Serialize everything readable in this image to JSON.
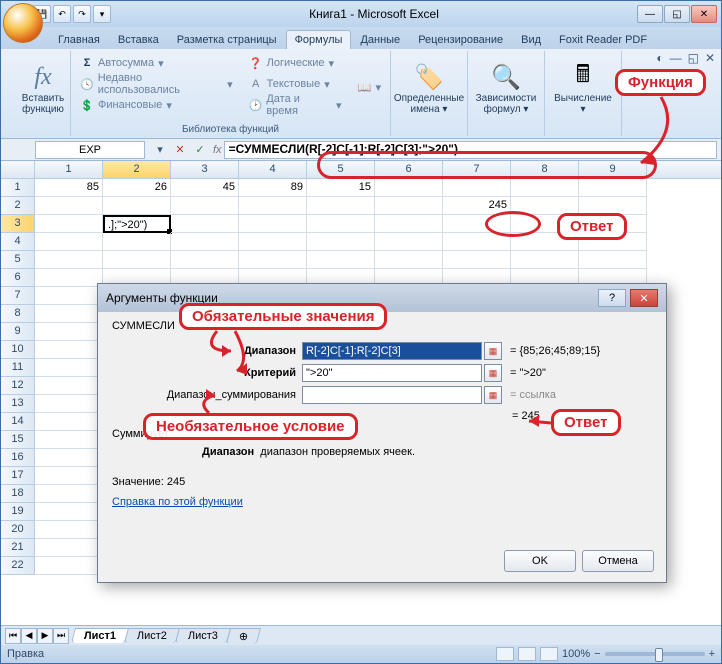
{
  "window": {
    "title": "Книга1 - Microsoft Excel"
  },
  "tabs": [
    "Главная",
    "Вставка",
    "Разметка страницы",
    "Формулы",
    "Данные",
    "Рецензирование",
    "Вид",
    "Foxit Reader PDF"
  ],
  "active_tab": "Формулы",
  "ribbon": {
    "insert_fn_top": "Вставить",
    "insert_fn_bottom": "функцию",
    "lib_label": "Библиотека функций",
    "autosum": "Автосумма",
    "recent": "Недавно использовались",
    "financial": "Финансовые",
    "logical": "Логические",
    "text": "Текстовые",
    "datetime": "Дата и время",
    "names_top": "Определенные",
    "names_bottom": "имена",
    "deps_top": "Зависимости",
    "deps_bottom": "формул",
    "calc": "Вычисление"
  },
  "namebox": "EXP",
  "formula": "=СУММЕСЛИ(R[-2]C[-1]:R[-2]C[3];\">20\")",
  "grid": {
    "cols": [
      "1",
      "2",
      "3",
      "4",
      "5",
      "6",
      "7",
      "8",
      "9"
    ],
    "row1": [
      "85",
      "26",
      "45",
      "89",
      "15",
      "",
      "",
      "",
      ""
    ],
    "row2": [
      "",
      "",
      "",
      "",
      "",
      "",
      "245",
      "",
      ""
    ],
    "row3_editing": ".];\">20\")"
  },
  "sheets": [
    "Лист1",
    "Лист2",
    "Лист3"
  ],
  "status": "Правка",
  "zoom": "100%",
  "dialog": {
    "title": "Аргументы функции",
    "fn": "СУММЕСЛИ",
    "arg1_label": "Диапазон",
    "arg1_value": "R[-2]C[-1]:R[-2]C[3]",
    "arg1_result": "= {85;26;45;89;15}",
    "arg2_label": "Критерий",
    "arg2_value": "\">20\"",
    "arg2_result": "= \">20\"",
    "arg3_label": "Диапазон_суммирования",
    "arg3_value": "",
    "arg3_result": "= ссылка",
    "result_eq": "= 245",
    "summarizes": "Суммирует",
    "desc_b": "Диапазон",
    "desc_rest": "диапазон проверяемых ячеек.",
    "value_label": "Значение:",
    "value": "245",
    "help": "Справка по этой функции",
    "ok": "OK",
    "cancel": "Отмена"
  },
  "callouts": {
    "function": "Функция",
    "answer": "Ответ",
    "required": "Обязательные значения",
    "optional": "Необязательное условие",
    "answer2": "Ответ"
  },
  "icons": {
    "sigma": "Σ",
    "fx": "fx"
  }
}
